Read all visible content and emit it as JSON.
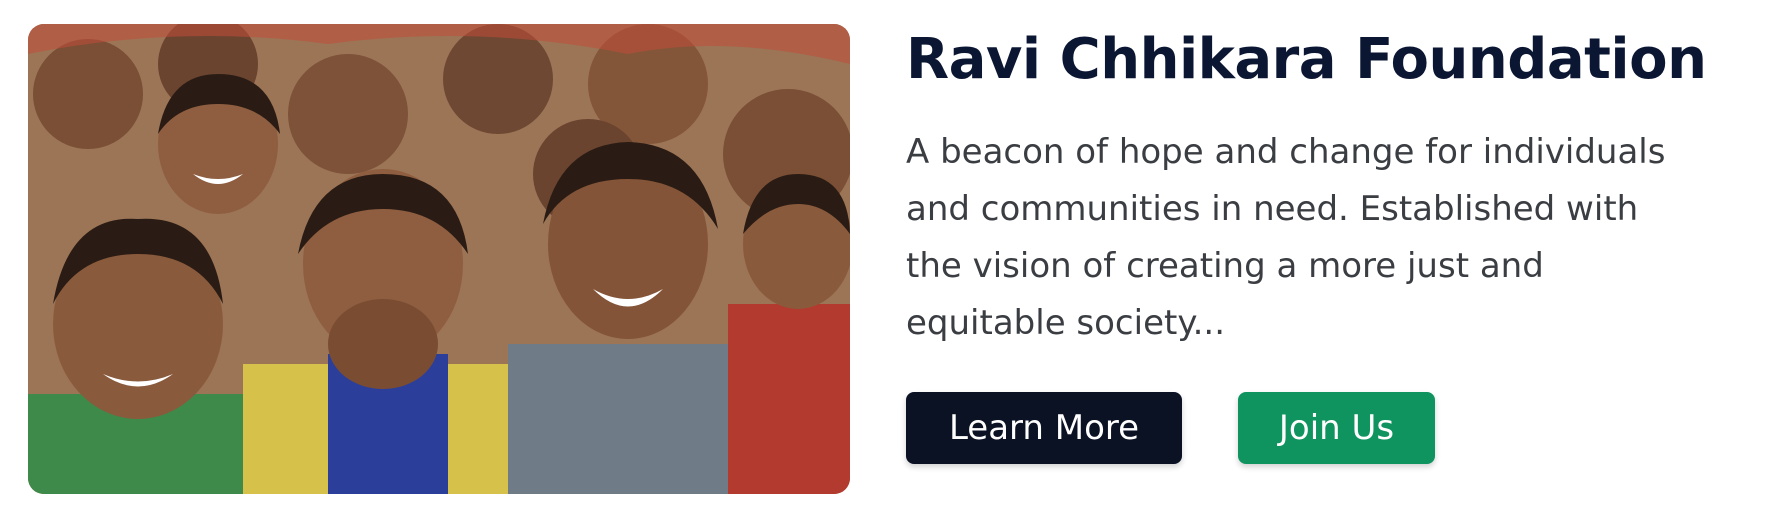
{
  "hero_image": {
    "icon": "photo-children-smiling",
    "description_colors": {
      "background": "#b38a6a",
      "skin": "#8a5a3c",
      "shirt_green": "#3e8a4a",
      "shirt_blue": "#2b3f9a",
      "shirt_yellow": "#d6c24a",
      "shirt_grey": "#6f7b86",
      "shirt_red": "#b23a2e",
      "hair": "#2a1c14"
    }
  },
  "content": {
    "title": "Ravi Chhikara Foundation",
    "description_lines": [
      "A beacon of hope and change for individuals",
      "and communities in need. Established with",
      "the vision of creating a more just and",
      "equitable society..."
    ]
  },
  "actions": {
    "learn_more_label": "Learn More",
    "join_us_label": "Join Us"
  },
  "colors": {
    "title": "#0b1633",
    "text": "#3a3d42",
    "primary_button": "#0a1224",
    "secondary_button": "#0f9460"
  }
}
